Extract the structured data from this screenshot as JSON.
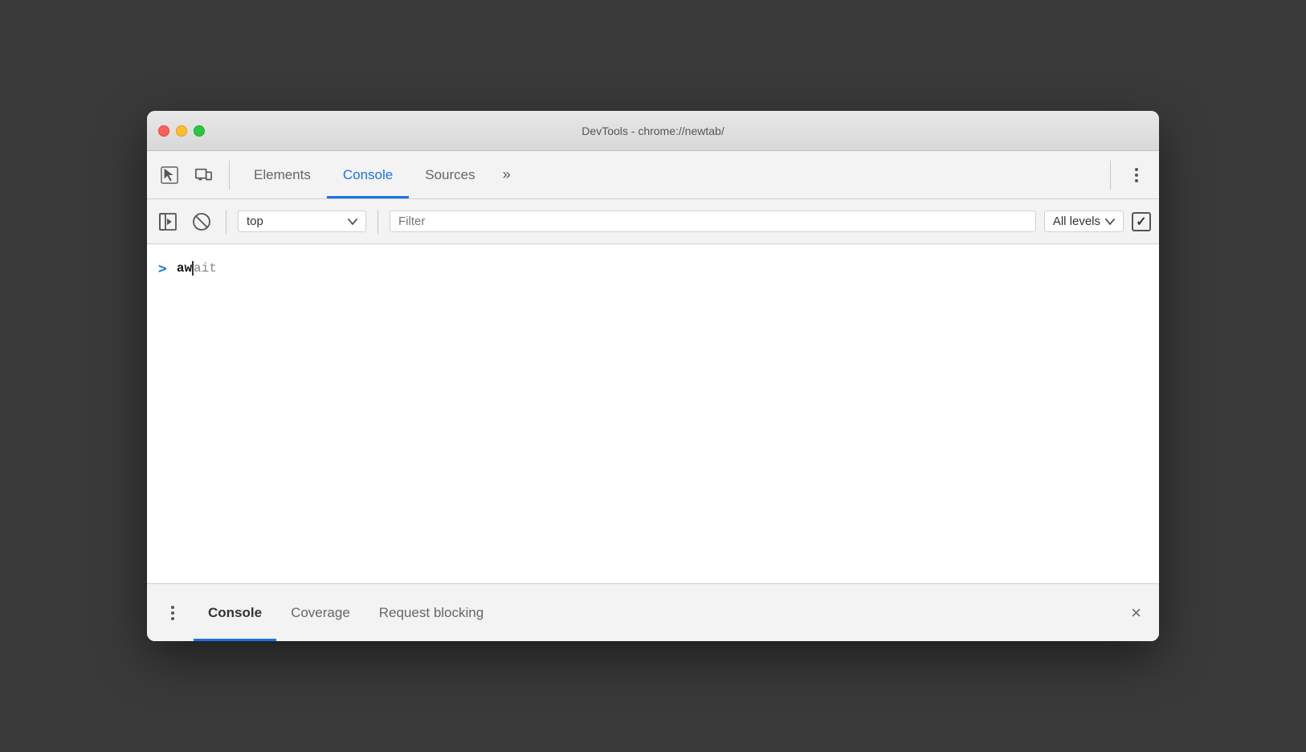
{
  "window": {
    "title": "DevTools - chrome://newtab/"
  },
  "titlebar": {
    "title": "DevTools - chrome://newtab/"
  },
  "toolbar": {
    "tabs": [
      {
        "id": "elements",
        "label": "Elements",
        "active": false
      },
      {
        "id": "console",
        "label": "Console",
        "active": true
      },
      {
        "id": "sources",
        "label": "Sources",
        "active": false
      }
    ],
    "more_label": "»",
    "menu_label": "⋮"
  },
  "console_toolbar": {
    "context": "top",
    "filter_placeholder": "Filter",
    "levels_label": "All levels"
  },
  "console": {
    "prompt_symbol": ">",
    "input_typed": "aw",
    "input_autocomplete": "ait"
  },
  "drawer": {
    "menu_label": "⋮",
    "tabs": [
      {
        "id": "console",
        "label": "Console",
        "active": true
      },
      {
        "id": "coverage",
        "label": "Coverage",
        "active": false
      },
      {
        "id": "request-blocking",
        "label": "Request blocking",
        "active": false
      }
    ],
    "close_label": "×"
  }
}
